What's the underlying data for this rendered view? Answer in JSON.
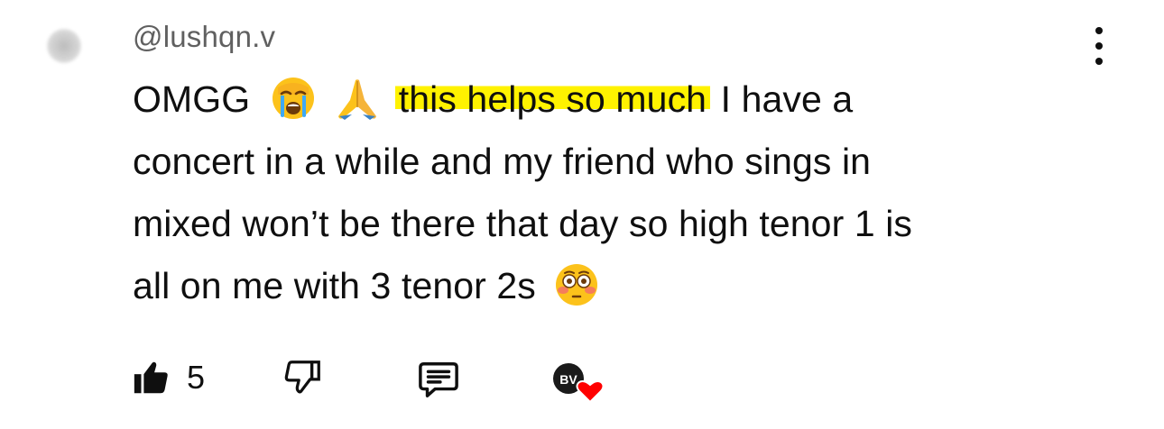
{
  "comment": {
    "username": "@lushqn.v",
    "text_part1": "OMGG",
    "text_highlighted": "this helps so much",
    "text_line1_rest": "I have a",
    "text_line2": "concert in a while and my friend who sings in",
    "text_line3": "mixed won’t be there that day so high tenor 1 is",
    "text_line4": "all on me with 3 tenor 2s",
    "emoji_after_omgg": [
      "loudly-crying-face",
      "folded-hands"
    ],
    "emoji_end": "flushed-face",
    "highlight_color": "#fff200"
  },
  "actions": {
    "like_count": "5",
    "creator_heart_initials": "BV",
    "heart_color": "#ff0000"
  },
  "icons": {
    "like": "thumbs-up-filled-icon",
    "dislike": "thumbs-down-outline-icon",
    "reply": "comment-reply-icon",
    "more": "vertical-ellipsis-icon",
    "creator_heart": "creator-heart-icon"
  }
}
